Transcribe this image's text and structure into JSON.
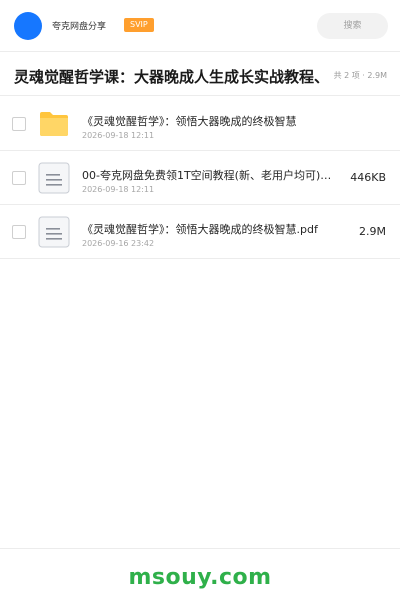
{
  "header": {
    "share_name": "夸克网盘分享",
    "badge": "SVIP",
    "search_placeholder": "搜索"
  },
  "title_row": {
    "title": "灵魂觉醒哲学课：大器晚成人生成长实战教程、",
    "summary": "共 2 项 · 2.9M"
  },
  "files": [
    {
      "type": "folder",
      "icon": "folder-icon",
      "name": "《灵魂觉醒哲学》：领悟大器晚成的终极智慧",
      "date": "2026-09-18 12:11",
      "size": ""
    },
    {
      "type": "file",
      "icon": "document-icon",
      "name": "00-夸克网盘免费领1T空间教程(新、老用户均可)…",
      "date": "2026-09-18 12:11",
      "size": "446KB"
    },
    {
      "type": "file",
      "icon": "document-icon",
      "name": "《灵魂觉醒哲学》：领悟大器晚成的终极智慧.pdf",
      "date": "2026-09-16 23:42",
      "size": "2.9M"
    }
  ],
  "footer": {
    "watermark": "msouy.com"
  },
  "colors": {
    "avatar": "#1677ff",
    "badge": "#ff9f2e",
    "folder": "#ffc53d",
    "watermark": "#2fb04a"
  }
}
